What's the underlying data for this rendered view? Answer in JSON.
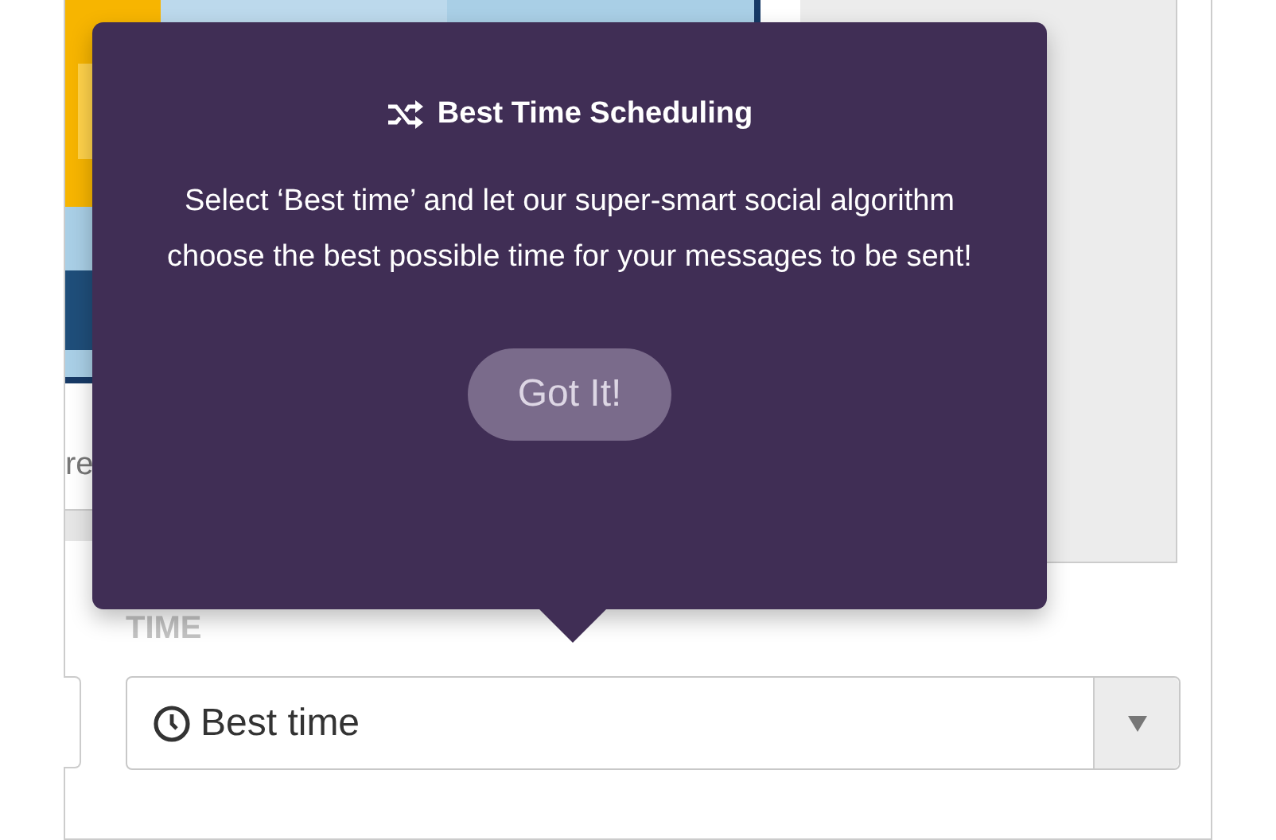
{
  "background": {
    "caption": "re"
  },
  "tooltip": {
    "title": "Best Time Scheduling",
    "body": "Select ‘Best time’ and let our super-smart social algorithm choose the best possible time for your messages to be sent!",
    "button": "Got It!"
  },
  "time_field": {
    "label": "TIME",
    "value": "Best time"
  }
}
